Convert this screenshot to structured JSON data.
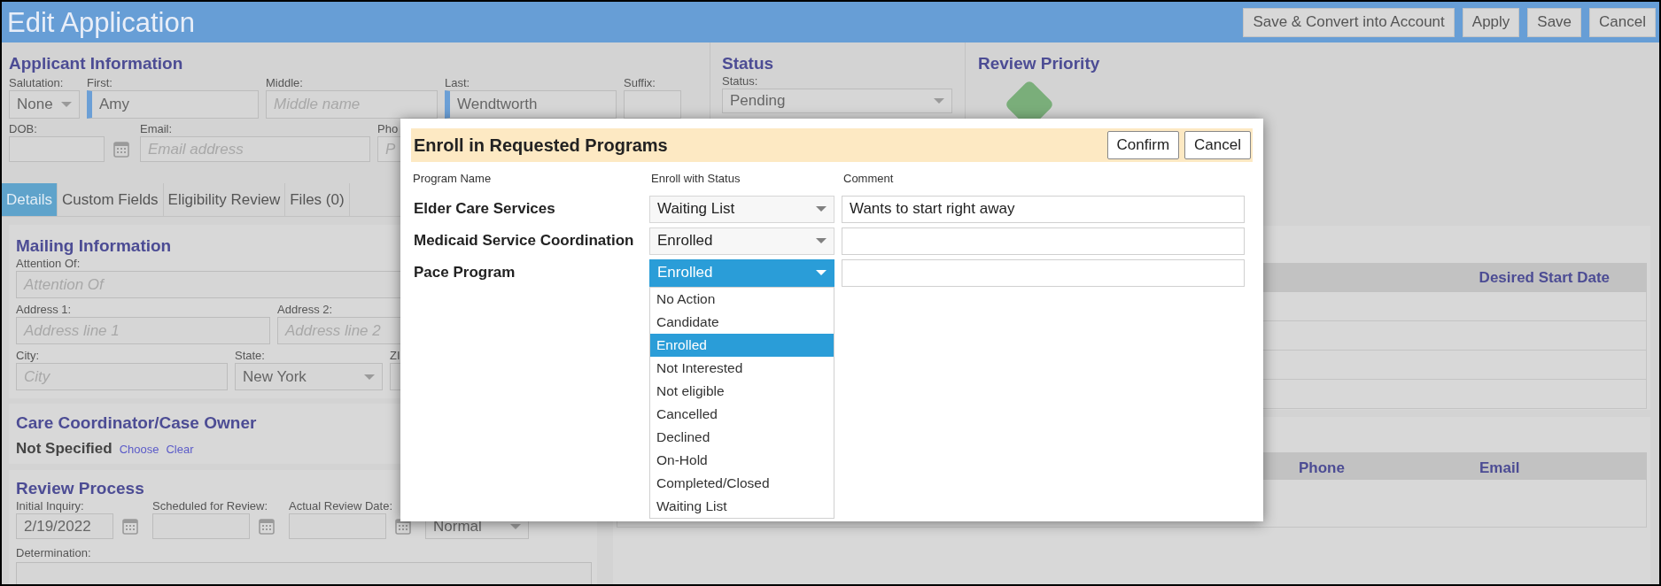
{
  "window": {
    "title": "Edit Application"
  },
  "toolbar_buttons": [
    "Save & Convert into Account",
    "Apply",
    "Save",
    "Cancel"
  ],
  "applicant_information": {
    "heading": "Applicant Information",
    "rows": [
      [
        {
          "kind": "select",
          "label": "Salutation:",
          "value": "None",
          "required": false
        },
        {
          "kind": "text",
          "label": "First:",
          "value": "Amy",
          "required": true
        },
        {
          "kind": "text",
          "label": "Middle:",
          "placeholder": "Middle name",
          "required": false
        },
        {
          "kind": "text",
          "label": "Last:",
          "value": "Wendtworth",
          "required": true
        },
        {
          "kind": "text",
          "label": "Suffix:",
          "required": false
        }
      ],
      [
        {
          "kind": "date",
          "label": "DOB:",
          "required": false
        },
        {
          "kind": "text",
          "label": "Email:",
          "placeholder": "Email address",
          "required": false
        },
        {
          "kind": "text",
          "label": "Pho",
          "placeholder": "P",
          "required": false
        }
      ]
    ]
  },
  "status_panel": {
    "heading": "Status",
    "label": "Status:",
    "value": "Pending"
  },
  "review_priority": {
    "heading": "Review Priority"
  },
  "tabs": [
    {
      "label": "Details",
      "selected": true
    },
    {
      "label": "Custom Fields",
      "selected": false
    },
    {
      "label": "Eligibility Review",
      "selected": false
    },
    {
      "label": "Files (0)",
      "selected": false
    }
  ],
  "mailing_information": {
    "heading": "Mailing Information",
    "rows": [
      [
        {
          "kind": "text",
          "label": "Attention Of:",
          "placeholder": "Attention Of"
        }
      ],
      [
        {
          "kind": "text",
          "label": "Address 1:",
          "placeholder": "Address line 1"
        },
        {
          "kind": "text",
          "label": "Address 2:",
          "placeholder": "Address line 2"
        }
      ],
      [
        {
          "kind": "text",
          "label": "City:",
          "placeholder": "City"
        },
        {
          "kind": "select",
          "label": "State:",
          "value": "New York"
        },
        {
          "kind": "text",
          "label": "ZI"
        }
      ]
    ]
  },
  "care_coordinator": {
    "heading": "Care Coordinator/Case Owner",
    "value": "Not Specified",
    "links": [
      "Choose",
      "Clear"
    ]
  },
  "review_process": {
    "heading": "Review Process",
    "fields": [
      {
        "kind": "date",
        "label": "Initial Inquiry:",
        "value": "2/19/2022"
      },
      {
        "kind": "date",
        "label": "Scheduled for Review:"
      },
      {
        "kind": "date",
        "label": "Actual Review Date:"
      },
      {
        "kind": "select",
        "value": "Normal"
      }
    ],
    "determination_label": "Determination:"
  },
  "programs_table": {
    "columns": [
      "Desired Start Date"
    ]
  },
  "contacts_table": {
    "columns": [
      "Phone",
      "Email"
    ]
  },
  "dialog": {
    "title": "Enroll in Requested Programs",
    "buttons": [
      "Confirm",
      "Cancel"
    ],
    "columns": [
      "Program Name",
      "Enroll with Status",
      "Comment"
    ],
    "rows": [
      {
        "program": "Elder Care Services",
        "status": "Waiting List",
        "comment": "Wants to start right away",
        "open": false
      },
      {
        "program": "Medicaid Service Coordination",
        "status": "Enrolled",
        "open": false
      },
      {
        "program": "Pace Program",
        "status": "Enrolled",
        "open": true
      }
    ],
    "status_options": [
      {
        "label": "No Action",
        "selected": false
      },
      {
        "label": "Candidate",
        "selected": false
      },
      {
        "label": "Enrolled",
        "selected": true
      },
      {
        "label": "Not Interested",
        "selected": false
      },
      {
        "label": "Not eligible",
        "selected": false
      },
      {
        "label": "Cancelled",
        "selected": false
      },
      {
        "label": "Declined",
        "selected": false
      },
      {
        "label": "On-Hold",
        "selected": false
      },
      {
        "label": "Completed/Closed",
        "selected": false
      },
      {
        "label": "Waiting List",
        "selected": false
      }
    ]
  }
}
